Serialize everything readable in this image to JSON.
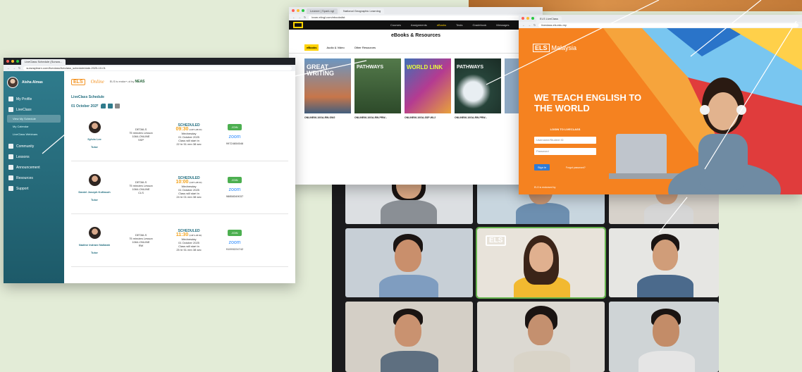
{
  "liveclass_window": {
    "tab_title": "LiveClass Schedule (Sunwa...",
    "url": "sunwaylearn.com/liveclass/liveclass_schedule/date-2025-10-01",
    "profile_name": "Aisha Almas",
    "nav": {
      "my_profile": "My Profile",
      "liveclass": "LiveClass",
      "sub_view_schedule": "View My Schedule",
      "sub_calendar": "My Calendar",
      "sub_webinars": "LiveClass Webinars",
      "community": "Community",
      "lessons": "Lessons",
      "announcement": "Announcement",
      "resources": "Resources",
      "support": "Support"
    },
    "logo_els": "ELS",
    "logo_online": "Online",
    "accredited_by": "ELS is endorsed by",
    "neas": "NEAS",
    "schedule_heading": "LiveClass Schedule",
    "schedule_date": "01 October 2025",
    "rows": [
      {
        "tutor": "Sylvia Lee",
        "role": "Tutor",
        "detail_label": "DETAILS",
        "lesson": "75 minutes Lesson",
        "course": "1064-ONLINE",
        "code": "SSP",
        "status": "SCHEDULED",
        "time": "09:30",
        "tz": "(GMT+08:00)",
        "weekday": "Wednesday",
        "date": "01 October 2025",
        "starts_label": "Class will start in",
        "countdown": "22 hr 51 mm 38 sec",
        "join": "JOIN",
        "zoom": "zoom",
        "meeting_id": "99724654546"
      },
      {
        "tutor": "Daniel Joseph Kofiasoh",
        "role": "Tutor",
        "detail_label": "DETAILS",
        "lesson": "75 minutes Lesson",
        "course": "1064-ONLINE",
        "code": "CLS",
        "status": "SCHEDULED",
        "time": "10:00",
        "tz": "(GMT+08:00)",
        "weekday": "Wednesday",
        "date": "01 October 2025",
        "starts_label": "Class will start in",
        "countdown": "24 hr 01 mm 38 sec",
        "join": "JOIN",
        "zoom": "zoom",
        "meeting_id": "98858349037"
      },
      {
        "tutor": "Nadine Indrani Nallaiah",
        "role": "Tutor",
        "detail_label": "DETAILS",
        "lesson": "75 minutes Lesson",
        "course": "1064-ONLINE",
        "code": "RW",
        "status": "SCHEDULED",
        "time": "11:30",
        "tz": "(GMT+08:00)",
        "weekday": "Wednesday",
        "date": "01 October 2025",
        "starts_label": "Class will start in",
        "countdown": "25 hr 51 mm 38 sec",
        "join": "JOIN",
        "zoom": "zoom",
        "meeting_id": "91093224742"
      }
    ]
  },
  "ebooks_window": {
    "tab1": "Learner | Spark.ngl",
    "tab2": "National Geographic Learning",
    "url": "learn.eltngl.com/ebookslist",
    "nav": [
      "Courses",
      "Assignments",
      "eBooks",
      "Tests",
      "Gradebook",
      "Messages"
    ],
    "page_title": "eBooks & Resources",
    "tabs": [
      "eBooks",
      "Audio & Video",
      "Other Resources"
    ],
    "books": [
      {
        "cover_title": "GREAT WRITING",
        "caption": "ONLINE06-10GA-RW-GW2",
        "color": "#5b84ae"
      },
      {
        "cover_title": "PATHWAYS",
        "caption": "ONLINE06-10GA-RW-PRW...",
        "color": "#3d6b3a"
      },
      {
        "cover_title": "WORLD LINK",
        "caption": "ONLINE06-10GA-SSP-WL2",
        "color": "#8a3f8f"
      },
      {
        "cover_title": "PATHWAYS",
        "caption": "ONLINE06-10GA-RW-PRW...",
        "color": "#2f4a3a"
      },
      {
        "cover_title": "",
        "caption": "",
        "color": "#8fa9c4"
      }
    ]
  },
  "els_window": {
    "tab": "ELS LiveClass",
    "url": "liveclass.els.edu.my",
    "logo": "ELS",
    "country": "Malaysia",
    "headline": "WE TEACH ENGLISH TO THE WORLD",
    "login_title": "LOGIN TO LIVECLASS",
    "username_placeholder": "Username/Student ID",
    "password_placeholder": "Password",
    "signin": "Sign in",
    "forgot": "Forgot password?",
    "footer": "ELS is endorsed by",
    "neas": "NEAS"
  },
  "video_window": {
    "badge": "ELS"
  },
  "colors": {
    "sidebar": "#2f7b8c",
    "els_orange": "#f58220",
    "join_green": "#4caf50",
    "time_amber": "#f3a21b",
    "background": "#e3ecd7"
  }
}
